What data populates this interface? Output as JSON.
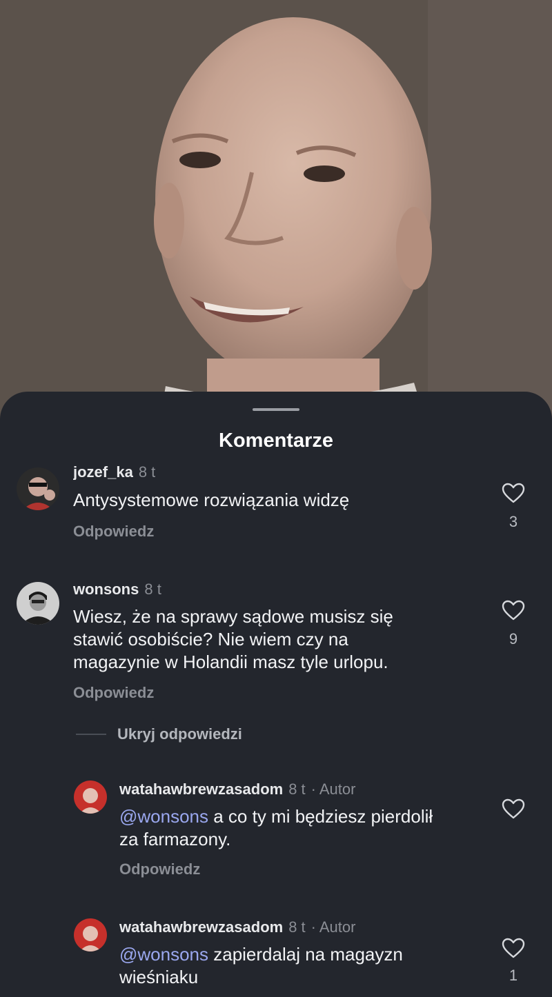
{
  "sheet": {
    "title": "Komentarze"
  },
  "comments": [
    {
      "username": "jozef_ka",
      "time": "8 t",
      "text": "Antysystemowe rozwiązania widzę",
      "reply_label": "Odpowiedz",
      "likes": "3"
    },
    {
      "username": "wonsons",
      "time": "8 t",
      "text": "Wiesz, że na sprawy sądowe musisz się\nstawić osobiście? Nie wiem czy na\nmagazynie w Holandii masz tyle urlopu.",
      "reply_label": "Odpowiedz",
      "likes": "9"
    }
  ],
  "hide_replies_label": "Ukryj odpowiedzi",
  "replies": [
    {
      "username": "watahawbrewzasadom",
      "time": "8 t",
      "author_label": "· Autor",
      "mention": "@wonsons",
      "text": " a co ty mi będziesz pierdolił\nza farmazony.",
      "reply_label": "Odpowiedz",
      "likes": ""
    },
    {
      "username": "watahawbrewzasadom",
      "time": "8 t",
      "author_label": "· Autor",
      "mention": "@wonsons",
      "text": " zapierdalaj na magayzn\nwieśniaku",
      "likes": "1"
    }
  ],
  "colors": {
    "background": "#23262d",
    "mention": "#9aa7ee",
    "muted": "#8b8e95"
  }
}
